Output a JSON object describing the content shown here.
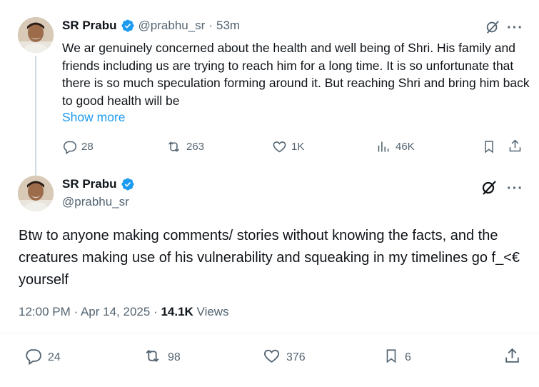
{
  "tweet1": {
    "name": "SR Prabu",
    "handle": "@prabhu_sr",
    "separator": "·",
    "time": "53m",
    "text": "We ar genuinely concerned about the health and well being of Shri. His family and friends including us are trying to reach him for a long time. It is so unfortunate that there is so much speculation forming around it. But reaching Shri and bring him back to good health will be",
    "show_more": "Show more",
    "replies": "28",
    "reposts": "263",
    "likes": "1K",
    "views": "46K"
  },
  "tweet2": {
    "name": "SR Prabu",
    "handle": "@prabhu_sr",
    "text": "Btw to anyone making comments/ stories without knowing the facts, and the creatures making use of his vulnerability and squeaking in my timelines go f_<€ yourself",
    "time": "12:00 PM",
    "date": "Apr 14, 2025",
    "views_count": "14.1K",
    "views_label": "Views",
    "replies": "24",
    "reposts": "98",
    "likes": "376",
    "bookmarks": "6"
  },
  "icons": {
    "verified": "verified-badge-icon",
    "grok": "grok-icon",
    "more": "more-dots-icon",
    "reply": "reply-icon",
    "repost": "repost-icon",
    "like": "heart-icon",
    "views": "views-chart-icon",
    "bookmark": "bookmark-icon",
    "share": "share-icon"
  },
  "colors": {
    "accent": "#1d9bf0",
    "text": "#0f1419",
    "secondary": "#536471"
  }
}
